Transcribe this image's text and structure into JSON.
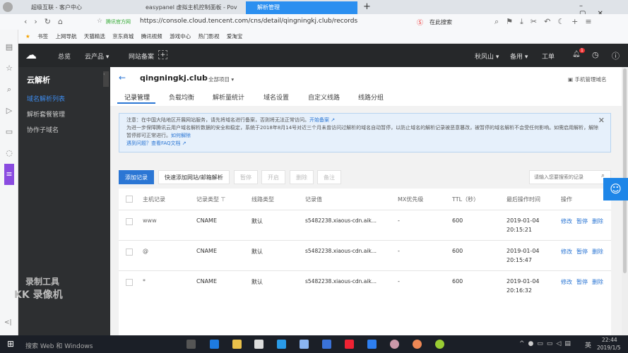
{
  "browser": {
    "tabs": [
      "超级互联 - 客户中心",
      "easypanel 虚拟主机控制面板 - Pov",
      "解析管理"
    ],
    "address_prefix": "腾讯官方网",
    "url": "https://console.cloud.tencent.com/cns/detail/qingningkj.club/records",
    "search_label": "在此搜索",
    "bookmarks": [
      "书签",
      "上网导航",
      "天猫精选",
      "京东商城",
      "腾讯视频",
      "游戏中心",
      "热门影视",
      "爱淘宝"
    ]
  },
  "topnav": {
    "items": [
      "总览",
      "云产品 ▾",
      "网站备案"
    ],
    "right": [
      "秋风山 ▾",
      "备用 ▾",
      "工单"
    ],
    "badge": "1"
  },
  "sidebar": {
    "title": "云解析",
    "items": [
      "域名解析列表",
      "解析套餐管理",
      "协作子域名"
    ],
    "watermark": [
      "录制工具",
      "KK 录像机"
    ]
  },
  "header": {
    "domain": "qingningkj.club",
    "project": "全部项目",
    "mobile": "手机管理域名",
    "tabs": [
      "记录管理",
      "负载均衡",
      "解析量统计",
      "域名设置",
      "自定义线路",
      "线路分组"
    ]
  },
  "notice": {
    "line1": "注意：在中国大陆地区开展网站服务，请先将域名进行备案，否则将无法正常访问。",
    "line1_link": "开始备案",
    "line2": "为进一步保障腾讯云用户域名解析数据的安全和稳定，系统于2018年8月14号对近三个月未曾访问过解析的域名自动暂停，以防止域名的解析记录被恶意篡改，被暂停的域名解析不会受任何影响。如需启用解析，解除暂停即可正常进行。",
    "line2_link": "如何解除",
    "line3": "遇到问题？查看FAQ文档"
  },
  "toolbar": {
    "buttons": [
      "添加记录",
      "快速添加网站/邮箱解析",
      "暂停",
      "开启",
      "删除",
      "备注"
    ],
    "search_placeholder": "请输入您要搜索的记录"
  },
  "table": {
    "headers": [
      "主机记录",
      "记录类型",
      "线路类型",
      "记录值",
      "MX优先级",
      "TTL（秒）",
      "最后操作时间",
      "操作"
    ],
    "rows": [
      {
        "host": "www",
        "type": "CNAME",
        "line": "默认",
        "value": "s5482238.xiaous-cdn.aik...",
        "mx": "-",
        "ttl": "600",
        "date": "2019-01-04",
        "time": "20:15:21"
      },
      {
        "host": "@",
        "type": "CNAME",
        "line": "默认",
        "value": "s5482238.xiaous-cdn.aik...",
        "mx": "-",
        "ttl": "600",
        "date": "2019-01-04",
        "time": "20:15:47"
      },
      {
        "host": "*",
        "type": "CNAME",
        "line": "默认",
        "value": "s5482238.xiaous-cdn.aik...",
        "mx": "-",
        "ttl": "600",
        "date": "2019-01-04",
        "time": "20:16:32"
      }
    ],
    "actions": [
      "修改",
      "暂停",
      "删除"
    ]
  },
  "taskbar": {
    "search": "搜索 Web 和 Windows",
    "time": "22:44",
    "date": "2019/1/5",
    "ime": "英"
  }
}
